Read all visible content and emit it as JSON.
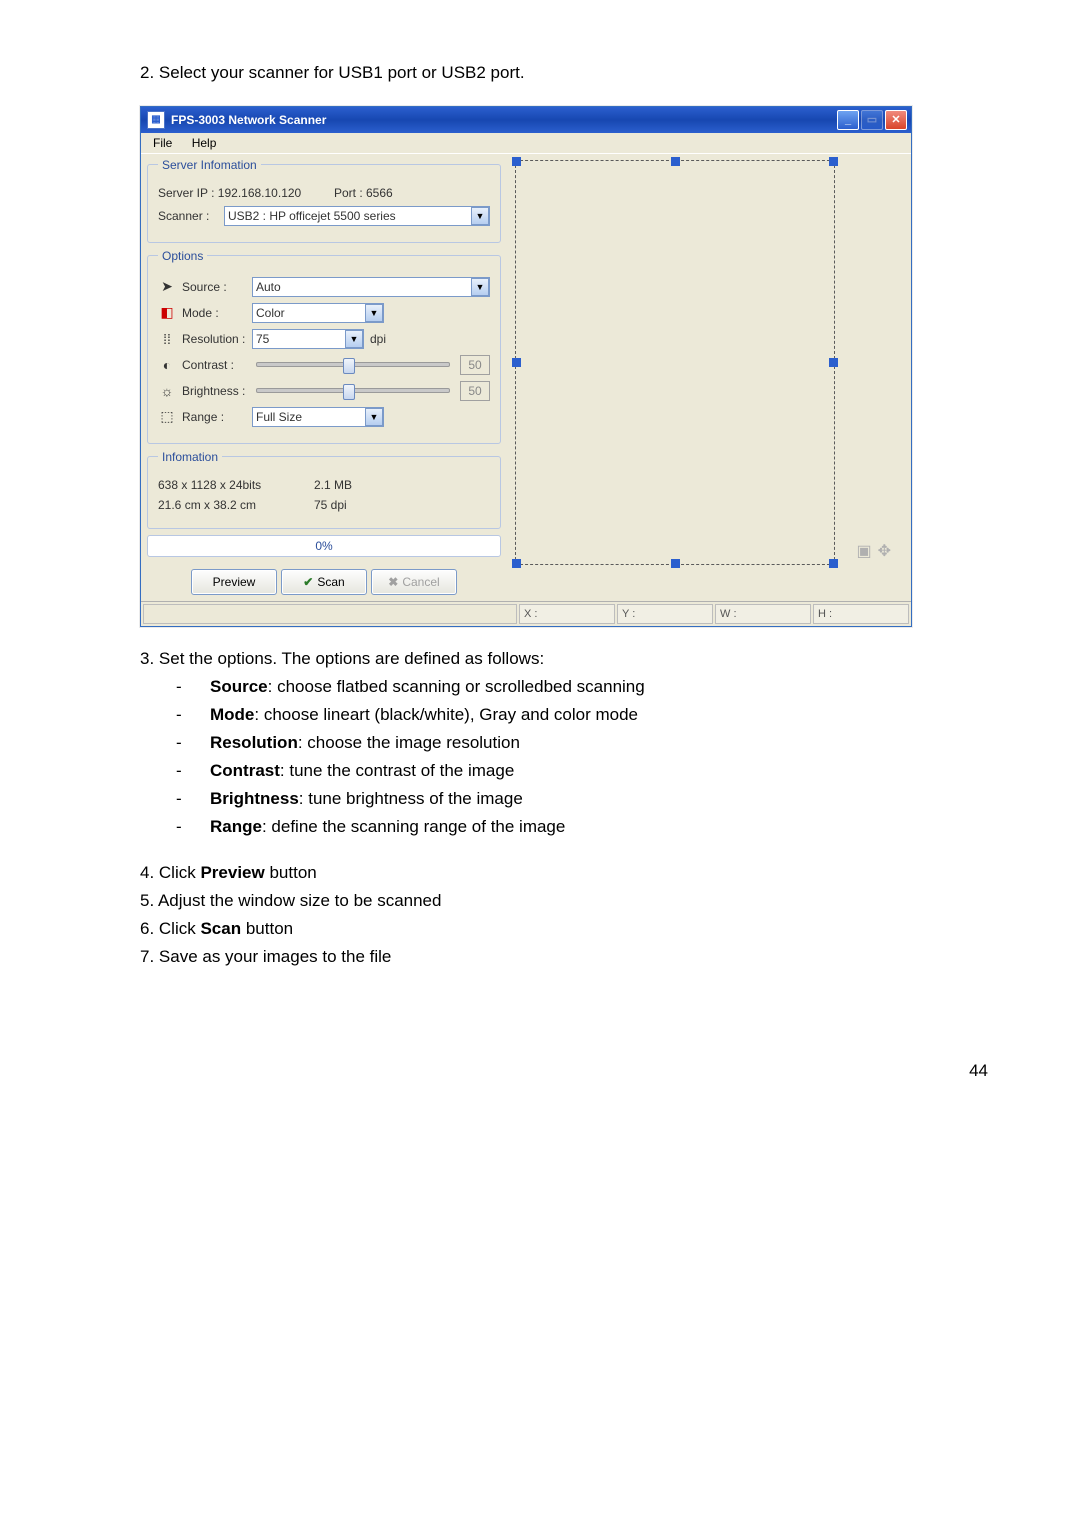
{
  "page_number": "44",
  "step2": "2.   Select your scanner for USB1 port or USB2 port.",
  "step3_intro": "3.   Set the options. The options are defined as follows:",
  "step3_items": [
    {
      "term": "Source",
      "desc": ": choose flatbed scanning or scrolledbed scanning"
    },
    {
      "term": "Mode",
      "desc": ": choose lineart (black/white), Gray and color mode"
    },
    {
      "term": "Resolution",
      "desc": ": choose the image resolution"
    },
    {
      "term": "Contrast",
      "desc": ": tune the contrast of the image"
    },
    {
      "term": "Brightness",
      "desc": ": tune brightness of the image"
    },
    {
      "term": "Range",
      "desc": ": define the scanning range of the image"
    }
  ],
  "step4": {
    "pre": "4.   Click ",
    "bold": "Preview",
    "post": " button"
  },
  "step5": "5.   Adjust the window size to be scanned",
  "step6": {
    "pre": "6.   Click ",
    "bold": "Scan",
    "post": " button"
  },
  "step7": "7.   Save as your images to the file",
  "window": {
    "title": "FPS-3003 Network Scanner",
    "menu": {
      "file": "File",
      "help": "Help"
    },
    "server_info": {
      "legend": "Server Infomation",
      "ip_label": "Server IP :  192.168.10.120",
      "port_label": "Port :  6566",
      "scanner_label": "Scanner :",
      "scanner_value": "USB2 : HP officejet 5500 series"
    },
    "options": {
      "legend": "Options",
      "source_label": "Source :",
      "source_value": "Auto",
      "mode_label": "Mode :",
      "mode_value": "Color",
      "resolution_label": "Resolution :",
      "resolution_value": "75",
      "resolution_unit": "dpi",
      "contrast_label": "Contrast :",
      "contrast_value": "50",
      "brightness_label": "Brightness :",
      "brightness_value": "50",
      "range_label": "Range :",
      "range_value": "Full Size"
    },
    "information": {
      "legend": "Infomation",
      "dims": "638 x 1128 x 24bits",
      "size": "2.1 MB",
      "physical": "21.6 cm x 38.2 cm",
      "dpi": "75 dpi"
    },
    "progress": "0%",
    "buttons": {
      "preview": "Preview",
      "scan": "Scan",
      "cancel": "Cancel"
    },
    "status": {
      "x": "X :",
      "y": "Y :",
      "w": "W :",
      "h": "H :"
    }
  }
}
